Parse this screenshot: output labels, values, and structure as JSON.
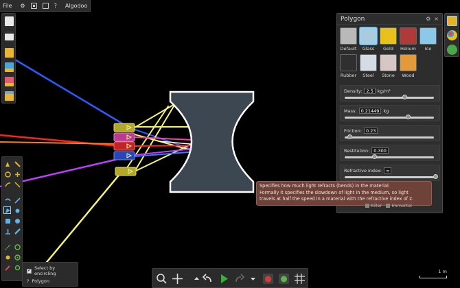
{
  "menu": {
    "file_label": "File",
    "export_label": "Algodoo"
  },
  "polygon_panel": {
    "title": "Polygon",
    "controls": {
      "gear": "⚙",
      "close": "×"
    },
    "materials": [
      {
        "label": "Default",
        "color": "#b9b9b9"
      },
      {
        "label": "Glass",
        "color": "#a8cbe0",
        "selected": true
      },
      {
        "label": "Gold",
        "color": "#e8c11c"
      },
      {
        "label": "Helium",
        "color": "#b03a3a"
      },
      {
        "label": "Ice",
        "color": "#8cc8e8"
      },
      {
        "label": "Rubber",
        "color": "#2f2f2f"
      },
      {
        "label": "Steel",
        "color": "#d6dce6"
      },
      {
        "label": "Stone",
        "color": "#d7c7c4"
      },
      {
        "label": "Wood",
        "color": "#e39b3a"
      }
    ],
    "properties": [
      {
        "label": "Density:",
        "value": "2.5",
        "unit": "kg/m²",
        "fraction": 0.66
      },
      {
        "label": "Mass:",
        "value": "0.21449",
        "unit": "kg",
        "fraction": 0.7
      },
      {
        "label": "Friction:",
        "value": "0.23",
        "unit": "",
        "fraction": 0.06
      },
      {
        "label": "Restitution:",
        "value": "0.300",
        "unit": "",
        "fraction": 0.33
      },
      {
        "label": "Refractive index:",
        "value": "∞",
        "unit": "",
        "fraction": 1.0
      }
    ],
    "footer": {
      "killer": "Killer",
      "immortal": "Immortal"
    }
  },
  "tooltip": {
    "lines": [
      "Specifies how much light refracts (bends) in the material.",
      "Formally it specifies the slowdown of light in the medium, so light",
      "travels at half the speed in a material with the refractive index of 2."
    ]
  },
  "select_box": {
    "option_label": "Select by encircling",
    "shape_label": "Polygon"
  },
  "scale_label": "1 m",
  "colors": {
    "panel_bg": "#2d2d2d",
    "lens_fill": "#3c4752",
    "lens_stroke": "#ffffff",
    "tooltip_bg": "#6e4239"
  }
}
